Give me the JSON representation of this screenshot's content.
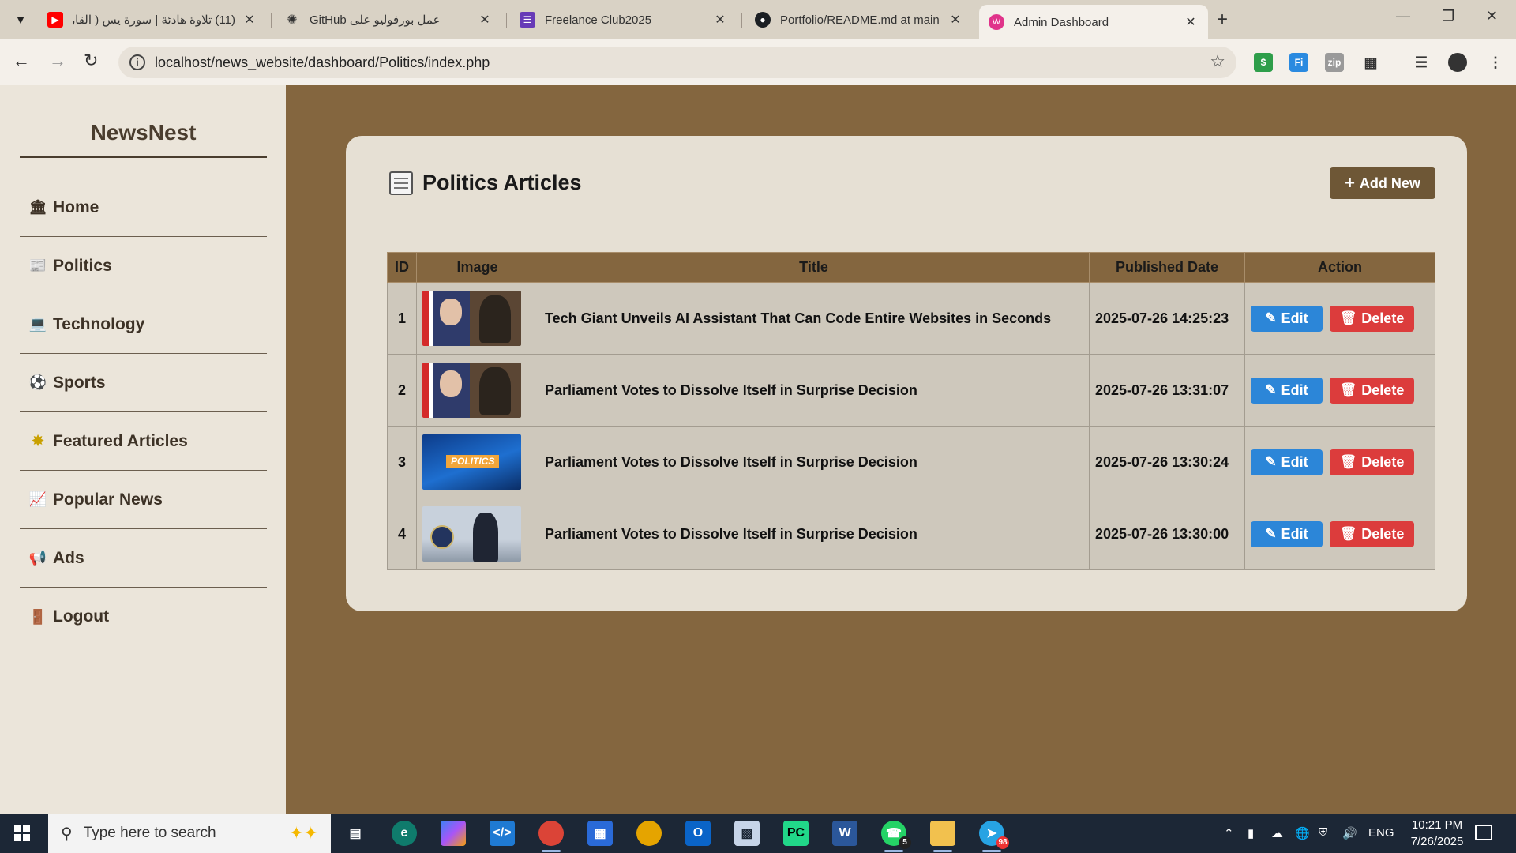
{
  "browser": {
    "tabs": [
      {
        "title": "(11) تلاوة هادئة | سورة يس ( القار",
        "favicon": "youtube-icon",
        "active": false
      },
      {
        "title": "عمل بورفوليو على GitHub",
        "favicon": "chatgpt-icon",
        "active": false
      },
      {
        "title": "Freelance Club2025",
        "favicon": "forms-icon",
        "active": false
      },
      {
        "title": "Portfolio/README.md at main · ",
        "favicon": "github-icon",
        "active": false
      },
      {
        "title": "Admin Dashboard",
        "favicon": "admin-icon",
        "active": true
      }
    ],
    "url": "localhost/news_website/dashboard/Politics/index.php"
  },
  "sidebar": {
    "brand": "NewsNest",
    "items": [
      {
        "label": "Home",
        "icon": "bank-icon"
      },
      {
        "label": "Politics",
        "icon": "newspaper-icon"
      },
      {
        "label": "Technology",
        "icon": "laptop-icon"
      },
      {
        "label": "Sports",
        "icon": "soccer-ball-icon"
      },
      {
        "label": "Featured Articles",
        "icon": "star-icon"
      },
      {
        "label": "Popular News",
        "icon": "chart-up-icon"
      },
      {
        "label": "Ads",
        "icon": "megaphone-icon"
      },
      {
        "label": "Logout",
        "icon": "door-icon"
      }
    ]
  },
  "main": {
    "title": "Politics Articles",
    "add_button": "Add New",
    "table": {
      "headers": {
        "id": "ID",
        "image": "Image",
        "title": "Title",
        "date": "Published Date",
        "action": "Action"
      },
      "rows": [
        {
          "id": "1",
          "thumb": "a",
          "title": "Tech Giant Unveils AI Assistant That Can Code Entire Websites in Seconds",
          "date": "2025-07-26 14:25:23"
        },
        {
          "id": "2",
          "thumb": "a",
          "title": "Parliament Votes to Dissolve Itself in Surprise Decision",
          "date": "2025-07-26 13:31:07"
        },
        {
          "id": "3",
          "thumb": "b",
          "title": "Parliament Votes to Dissolve Itself in Surprise Decision",
          "date": "2025-07-26 13:30:24"
        },
        {
          "id": "4",
          "thumb": "c",
          "title": "Parliament Votes to Dissolve Itself in Surprise Decision",
          "date": "2025-07-26 13:30:00"
        }
      ],
      "edit_label": "Edit",
      "delete_label": "Delete",
      "thumb_b_text": "POLITICS"
    }
  },
  "taskbar": {
    "search_placeholder": "Type here to search",
    "language": "ENG",
    "time": "10:21 PM",
    "date": "7/26/2025",
    "whatsapp_badge": "5",
    "telegram_badge": "98"
  },
  "colors": {
    "page_bg": "#84663f",
    "sidebar_bg": "#ebe5da",
    "card_bg": "#e6e0d4",
    "edit": "#2c86d8",
    "delete": "#dc3c3c",
    "add": "#6e5736"
  }
}
